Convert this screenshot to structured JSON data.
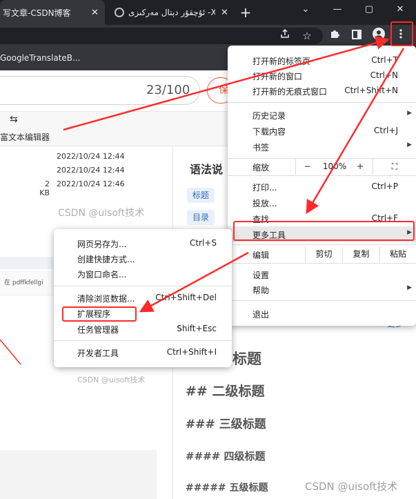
{
  "tabs": [
    {
      "title": "写文章-CSDN博客",
      "close": "✕"
    },
    {
      "title": "ئۇچقۇر دېتال مەركىزى -X",
      "close": "✕"
    }
  ],
  "new_tab": "+",
  "window": {
    "minimize": "⌄",
    "restore": "—",
    "maximize": "▢",
    "close": "✕"
  },
  "bookmarks": {
    "item": "GoogleTranslateB..."
  },
  "editor": {
    "counter": "23/100",
    "save_label": "保",
    "format_label": "富文本编辑器",
    "files": [
      {
        "size": "",
        "date": "2022/10/24 12:44"
      },
      {
        "size": "",
        "date": "2022/10/24 12:44"
      },
      {
        "size": "2 KB",
        "date": "2022/10/24 12:46"
      }
    ],
    "watermark1": "CSDN @uisoft技术",
    "watermark2": "CSDN @uisoft技术",
    "watermark3": "CSDN @uisoft技术",
    "ext_snippet": "在 pdffkfellgi",
    "syntax_title": "语法说",
    "chips": [
      "标题",
      "目录"
    ],
    "more_link": "更多",
    "headings": [
      "标题",
      "## 二级标题",
      "### 三级标题",
      "#### 四级标题",
      "##### 五级标题"
    ]
  },
  "main_menu": {
    "new_tab": {
      "label": "打开新的标签页",
      "shortcut": "Ctrl+T"
    },
    "new_window": {
      "label": "打开新的窗口",
      "shortcut": "Ctrl+N"
    },
    "incognito": {
      "label": "打开新的无痕式窗口",
      "shortcut": "Ctrl+Shift+N"
    },
    "history": {
      "label": "历史记录"
    },
    "downloads": {
      "label": "下载内容",
      "shortcut": "Ctrl+J"
    },
    "bookmarks": {
      "label": "书签"
    },
    "zoom": {
      "label": "缩放",
      "minus": "−",
      "value": "100%",
      "plus": "+",
      "fullscreen": "⛶"
    },
    "print": {
      "label": "打印...",
      "shortcut": "Ctrl+P"
    },
    "cast": {
      "label": "投放..."
    },
    "find": {
      "label": "查找...",
      "shortcut": "Ctrl+F"
    },
    "more_tools": {
      "label": "更多工具"
    },
    "edit": {
      "label": "编辑",
      "cut": "剪切",
      "copy": "复制",
      "paste": "粘贴"
    },
    "settings": {
      "label": "设置"
    },
    "help": {
      "label": "帮助"
    },
    "exit": {
      "label": "退出"
    }
  },
  "sub_menu": {
    "save_page": {
      "label": "网页另存为...",
      "shortcut": "Ctrl+S"
    },
    "create_shortcut": {
      "label": "创建快捷方式..."
    },
    "name_window": {
      "label": "为窗口命名..."
    },
    "clear_data": {
      "label": "清除浏览数据...",
      "shortcut": "Ctrl+Shift+Del"
    },
    "extensions": {
      "label": "扩展程序"
    },
    "task_manager": {
      "label": "任务管理器",
      "shortcut": "Shift+Esc"
    },
    "dev_tools": {
      "label": "开发者工具",
      "shortcut": "Ctrl+Shift+I"
    }
  },
  "colors": {
    "annotation": "#ff2b2b",
    "csdn_orange": "#fc5531",
    "chrome_dark": "#202124"
  },
  "icons": [
    "share-icon",
    "star-icon",
    "puzzle-icon",
    "sidepanel-icon",
    "profile-icon",
    "kebab-menu-icon",
    "swap-icon"
  ]
}
